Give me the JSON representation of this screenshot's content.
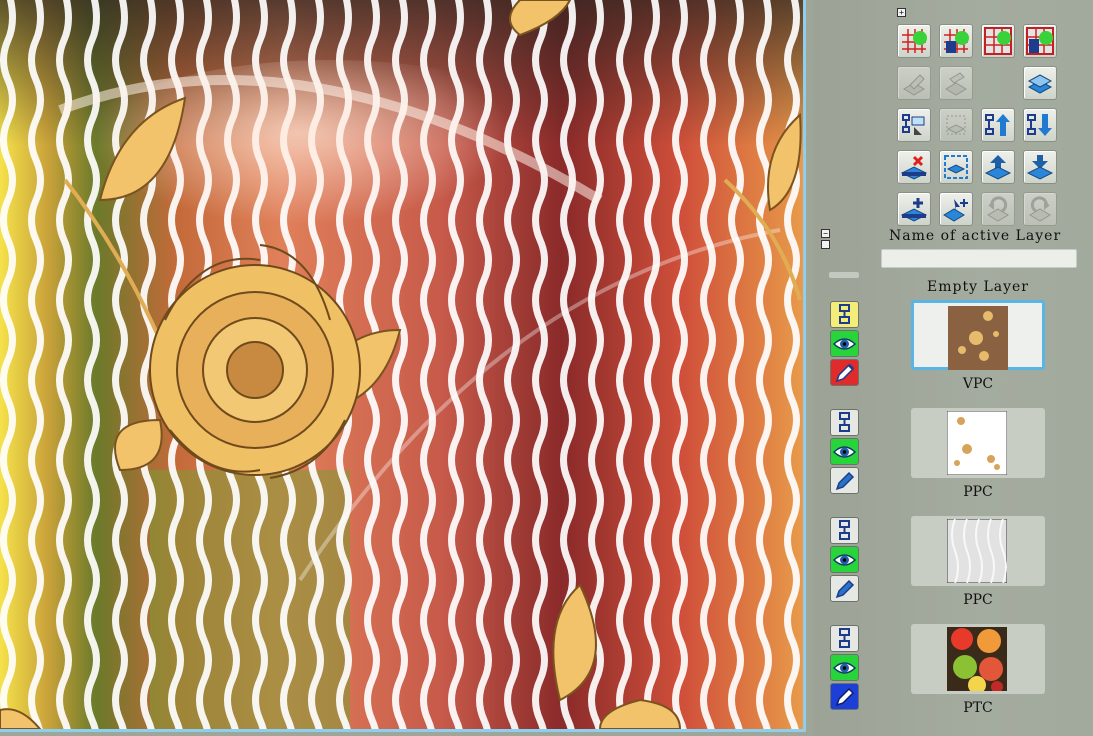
{
  "panel": {
    "active_layer_label": "Name of active Layer",
    "active_layer_value": "",
    "empty_layer_label": "Empty Layer"
  },
  "toolbar": {
    "buttons": [
      {
        "name": "grid-add-icon",
        "enabled": true
      },
      {
        "name": "grid-stamp-icon",
        "enabled": true
      },
      {
        "name": "grid-red-icon",
        "enabled": true
      },
      {
        "name": "grid-dark-icon",
        "enabled": true
      },
      {
        "name": "layer-copy-icon",
        "enabled": false
      },
      {
        "name": "layer-paste-icon",
        "enabled": false
      },
      {
        "name": "layer-stack-icon",
        "enabled": true
      },
      {
        "name": "layer-link-icon",
        "enabled": true
      },
      {
        "name": "layer-select-icon",
        "enabled": false
      },
      {
        "name": "move-layer-up-icon",
        "enabled": true
      },
      {
        "name": "move-layer-down-icon",
        "enabled": true
      },
      {
        "name": "delete-layer-icon",
        "enabled": true
      },
      {
        "name": "layer-frame-icon",
        "enabled": true
      },
      {
        "name": "merge-up-icon",
        "enabled": true
      },
      {
        "name": "merge-down-icon",
        "enabled": true
      },
      {
        "name": "add-layer-icon",
        "enabled": true
      },
      {
        "name": "layer-transform-icon",
        "enabled": true
      },
      {
        "name": "undo-layer-icon",
        "enabled": false
      },
      {
        "name": "redo-layer-icon",
        "enabled": false
      }
    ]
  },
  "layers": [
    {
      "name": "VPC",
      "active": true,
      "edit_color": "#e02b2b",
      "link_color": "#f3ee7a"
    },
    {
      "name": "PPC",
      "active": false,
      "edit_color": "#e6e8e3",
      "link_color": "#e6e8e3"
    },
    {
      "name": "PPC",
      "active": false,
      "edit_color": "#e6e8e3",
      "link_color": "#e6e8e3"
    },
    {
      "name": "PTC",
      "active": false,
      "edit_color": "#1c3fd8",
      "link_color": "#e6e8e3"
    }
  ],
  "colors": {
    "canvas_border": "#8ecff0",
    "panel_bg": "#a2a99d",
    "visibility_green": "#27d43a",
    "active_thumb_border": "#5ab4e4"
  }
}
